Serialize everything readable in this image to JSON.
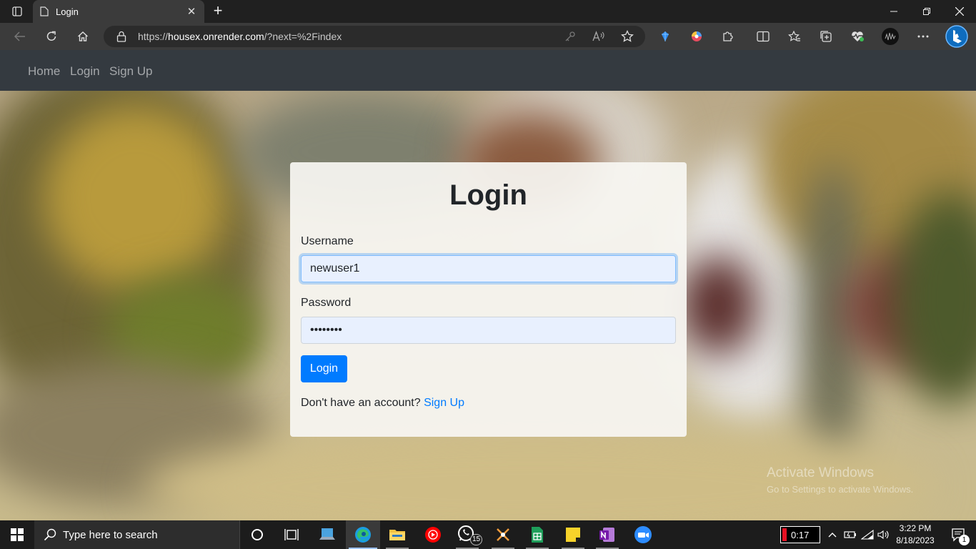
{
  "browser": {
    "tab_title": "Login",
    "tab_close": "✕",
    "new_tab": "+",
    "address_prefix": "https://",
    "address_host": "housex.onrender.com",
    "address_path": "/?next=%2Findex"
  },
  "navbar": {
    "home": "Home",
    "login": "Login",
    "signup": "Sign Up"
  },
  "form": {
    "title": "Login",
    "username_label": "Username",
    "username_value": "newuser1",
    "password_label": "Password",
    "password_value": "newuser1",
    "submit_label": "Login",
    "signup_prompt": "Don't have an account?",
    "signup_link": "Sign Up"
  },
  "watermark": {
    "title": "Activate Windows",
    "subtitle": "Go to Settings to activate Windows."
  },
  "taskbar": {
    "search_placeholder": "Type here to search",
    "whatsapp_badge": "15",
    "battery_time": "0:17",
    "time": "3:22 PM",
    "date": "8/18/2023",
    "notifications_count": "1"
  },
  "colors": {
    "navbar_bg": "#343a40",
    "primary": "#007bff",
    "input_autofill_bg": "#e8f0fe"
  }
}
